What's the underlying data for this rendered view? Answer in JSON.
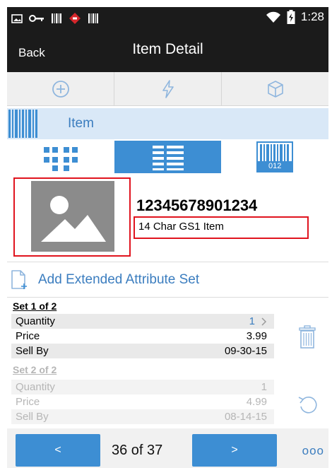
{
  "status_bar": {
    "time": "1:28",
    "icons": [
      "image-icon",
      "key-icon",
      "barcode-small-icon",
      "alert-diamond-icon",
      "barcode-small-icon",
      "wifi-icon",
      "battery-charging-icon"
    ]
  },
  "header": {
    "back_label": "Back",
    "title": "Item Detail"
  },
  "toolbar": {
    "buttons": [
      "add-icon",
      "lightning-icon",
      "box-icon"
    ]
  },
  "item_section": {
    "label": "Item"
  },
  "view_tabs": {
    "active": 1,
    "third_tab_text": "012"
  },
  "item": {
    "number": "12345678901234",
    "description": "14 Char GS1 Item"
  },
  "extended_attributes": {
    "add_label": "Add Extended Attribute Set"
  },
  "sets": [
    {
      "title": "Set 1 of 2",
      "rows": [
        {
          "label": "Quantity",
          "value": "1"
        },
        {
          "label": "Price",
          "value": "3.99"
        },
        {
          "label": "Sell By",
          "value": "09-30-15"
        }
      ]
    },
    {
      "title": "Set 2 of 2",
      "rows": [
        {
          "label": "Quantity",
          "value": "1"
        },
        {
          "label": "Price",
          "value": "4.99"
        },
        {
          "label": "Sell By",
          "value": "08-14-15"
        }
      ]
    }
  ],
  "pagination": {
    "prev_label": "<",
    "next_label": ">",
    "counter": "36 of 37",
    "more_label": "ooo"
  },
  "colors": {
    "accent": "#3d8ed3",
    "highlight_box": "#e0141e",
    "link_text": "#3b7dbf"
  }
}
